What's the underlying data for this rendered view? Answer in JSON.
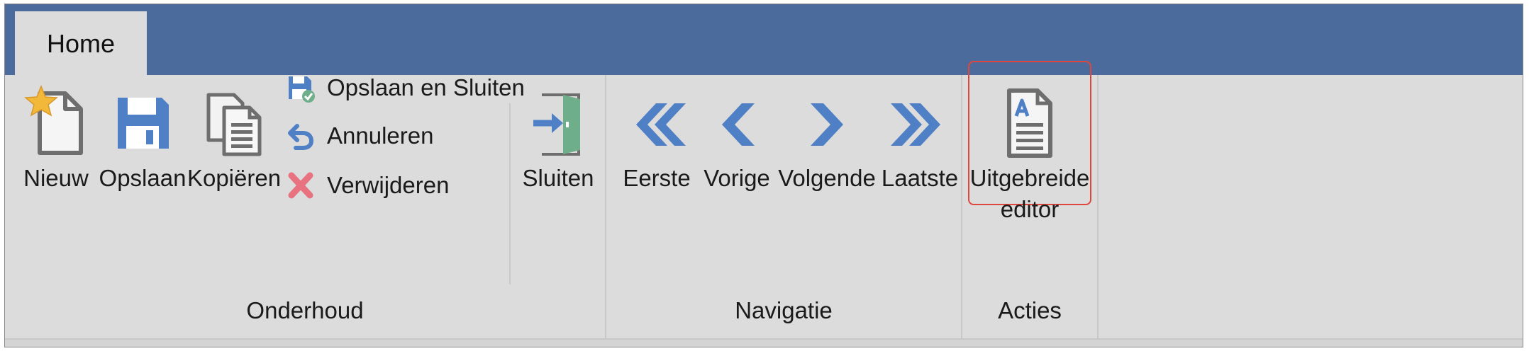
{
  "tabs": [
    {
      "label": "Home"
    }
  ],
  "groups": {
    "onderhoud": {
      "label": "Onderhoud",
      "large_buttons": [
        {
          "label": "Nieuw",
          "icon": "new-document-star-icon"
        },
        {
          "label": "Opslaan",
          "icon": "save-floppy-icon"
        },
        {
          "label": "Kopiëren",
          "icon": "copy-document-icon"
        }
      ],
      "small_buttons": [
        {
          "label": "Opslaan en Sluiten",
          "icon": "save-close-icon"
        },
        {
          "label": "Annuleren",
          "icon": "undo-arrow-icon"
        },
        {
          "label": "Verwijderen",
          "icon": "delete-x-icon"
        }
      ],
      "close_button": {
        "label": "Sluiten",
        "icon": "exit-door-icon"
      }
    },
    "navigatie": {
      "label": "Navigatie",
      "buttons": [
        {
          "label": "Eerste",
          "icon": "first-double-chevron-left-icon"
        },
        {
          "label": "Vorige",
          "icon": "previous-chevron-left-icon"
        },
        {
          "label": "Volgende",
          "icon": "next-chevron-right-icon"
        },
        {
          "label": "Laatste",
          "icon": "last-double-chevron-right-icon"
        }
      ]
    },
    "acties": {
      "label": "Acties",
      "buttons": [
        {
          "label_line1": "Uitgebreide",
          "label_line2": "editor",
          "icon": "text-document-icon",
          "highlighted": true
        }
      ]
    }
  },
  "colors": {
    "title_bar": "#4a6b9b",
    "ribbon_background": "#dcdcdc",
    "icon_blue": "#4f7fc4",
    "icon_gray": "#6e6e6e",
    "star_yellow": "#f2b83a",
    "delete_red": "#e8727f",
    "door_green": "#6fae8a",
    "highlight_red": "#e0473c"
  }
}
